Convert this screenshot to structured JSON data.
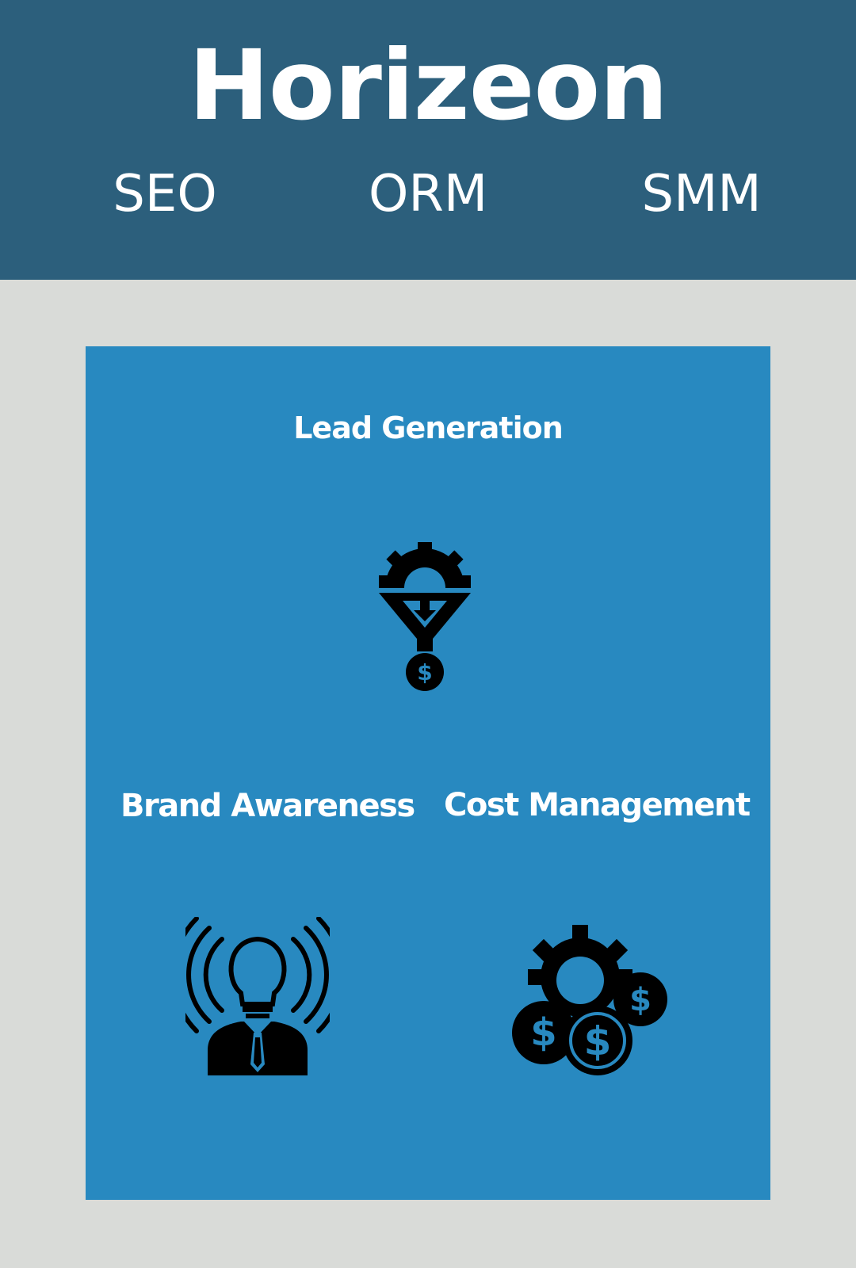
{
  "header": {
    "brand": "Horizeon",
    "nav": [
      {
        "label": "SEO"
      },
      {
        "label": "ORM"
      },
      {
        "label": "SMM"
      }
    ]
  },
  "features": [
    {
      "title": "Lead Generation",
      "icon": "funnel-gear-dollar-icon"
    },
    {
      "title": "Brand Awareness",
      "icon": "lightbulb-person-broadcast-icon"
    },
    {
      "title": "Cost Management",
      "icon": "gear-coins-icon"
    }
  ],
  "colors": {
    "header_bg": "#2c5f7c",
    "page_bg": "#d9dbd8",
    "panel_bg": "#2889c0",
    "text": "#ffffff",
    "icon": "#000000"
  }
}
